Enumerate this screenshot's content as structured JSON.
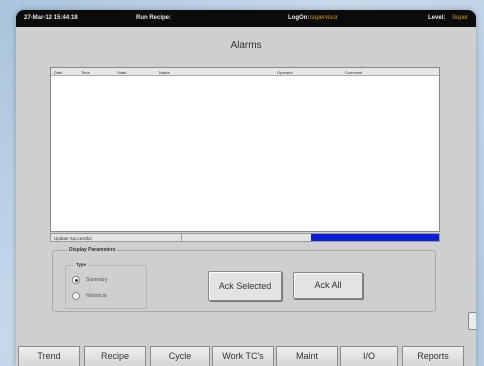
{
  "topbar": {
    "datetime": "27-Mar-12 15:44:18",
    "recipe_label": "Run Recipe:",
    "logon_label": "LogOn:",
    "logon_user": "supervisor",
    "level_label": "Level:",
    "level_value": "Super"
  },
  "alarms": {
    "title": "Alarms",
    "columns": [
      "Date",
      "Time",
      "State",
      "Name",
      "Operator",
      "Comment"
    ]
  },
  "status": {
    "message": "Update Successful",
    "progress": 1.0,
    "progress_color": "#0d1fd6"
  },
  "display_parameters": {
    "label": "Display Parameters",
    "type_label": "Type",
    "options": [
      "Summary",
      "Historical"
    ],
    "selected": "Summary"
  },
  "buttons": {
    "ack_selected": "Ack Selected",
    "ack_all": "Ack All"
  },
  "tabs": [
    "Trend",
    "Recipe",
    "Cycle",
    "Work TC's",
    "Maint",
    "I/O",
    "Reports"
  ]
}
